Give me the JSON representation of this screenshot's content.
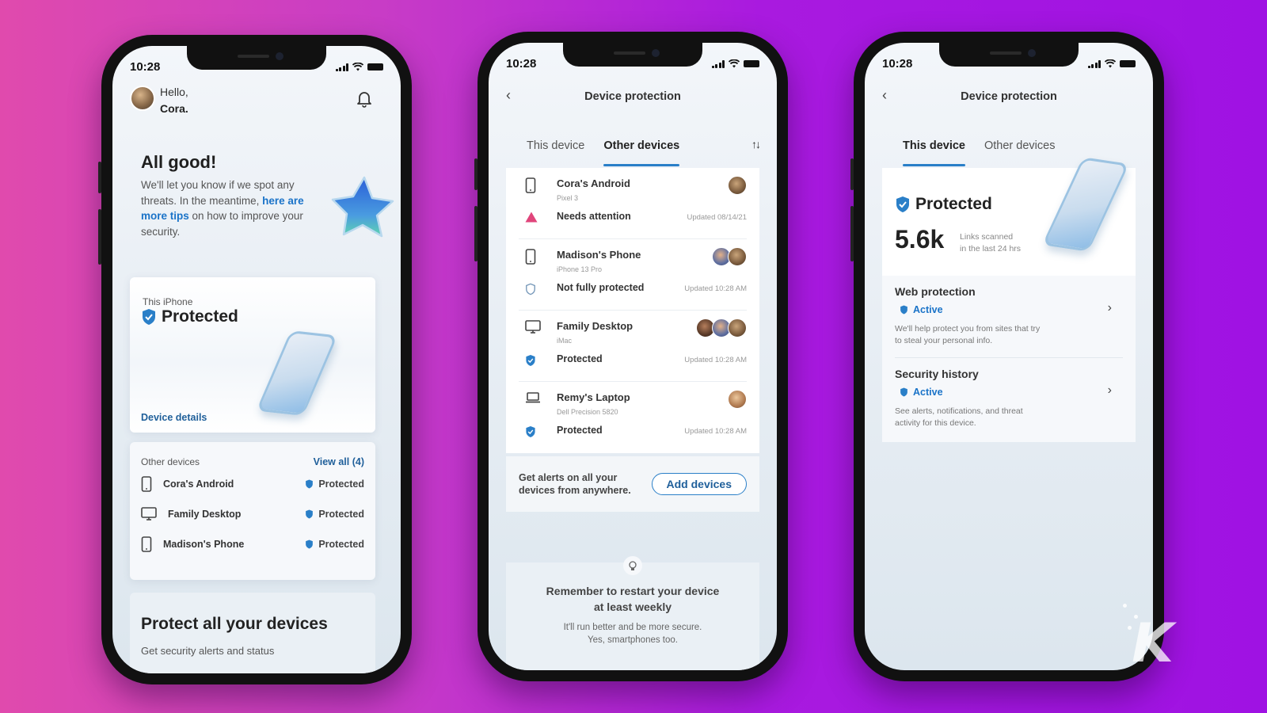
{
  "brand": {
    "accent": "#2a7fc8",
    "alert": "#e0457b",
    "background_left": "#e04aad",
    "background_right": "#9f12e3"
  },
  "phones": [
    {
      "status_bar": {
        "time": "10:28"
      },
      "greeting": {
        "hello": "Hello,",
        "name": "Cora."
      },
      "icons": {
        "notifications": "bell-icon"
      },
      "hero": {
        "title": "All good!",
        "body_before": "We'll let you know if we spot any threats. In the meantime, ",
        "link_text": "here are more tips",
        "body_after": " on how to improve your security."
      },
      "this_iphone": {
        "label": "This iPhone",
        "status": "Protected",
        "details_link": "Device details"
      },
      "other_devices": {
        "label": "Other devices",
        "view_all": "View all (4)",
        "items": [
          {
            "name": "Cora's Android",
            "icon": "phone-icon",
            "status": "Protected"
          },
          {
            "name": "Family Desktop",
            "icon": "desktop-icon",
            "status": "Protected"
          },
          {
            "name": "Madison's Phone",
            "icon": "phone-icon",
            "status": "Protected"
          }
        ]
      },
      "promo": {
        "title": "Protect all your devices",
        "subtitle": "Get security alerts and status"
      }
    },
    {
      "status_bar": {
        "time": "10:28"
      },
      "header": {
        "title": "Device protection",
        "back": "‹"
      },
      "tabs": [
        {
          "label": "This device",
          "active": false
        },
        {
          "label": "Other devices",
          "active": true
        }
      ],
      "sort_icon": "↑↓",
      "devices": [
        {
          "name": "Cora's Android",
          "model": "Pixel 3",
          "icon": "phone-icon",
          "status": "Needs attention",
          "status_icon": "warning-icon",
          "updated": "Updated 08/14/21",
          "avatars": [
            "av1"
          ]
        },
        {
          "name": "Madison's Phone",
          "model": "iPhone 13 Pro",
          "icon": "phone-icon",
          "status": "Not fully protected",
          "status_icon": "shield-outline-icon",
          "updated": "Updated 10:28 AM",
          "avatars": [
            "av2",
            "av1"
          ]
        },
        {
          "name": "Family Desktop",
          "model": "iMac",
          "icon": "desktop-icon",
          "status": "Protected",
          "status_icon": "shield-check-icon",
          "updated": "Updated 10:28 AM",
          "avatars": [
            "av3",
            "av2",
            "av1"
          ]
        },
        {
          "name": "Remy's Laptop",
          "model": "Dell Precision 5820",
          "icon": "laptop-icon",
          "status": "Protected",
          "status_icon": "shield-check-icon",
          "updated": "Updated 10:28 AM",
          "avatars": [
            "av4"
          ]
        }
      ],
      "alerts": {
        "text_line1": "Get alerts on all your",
        "text_line2": "devices from anywhere.",
        "button": "Add devices"
      },
      "tip": {
        "icon": "lightbulb-icon",
        "title_line1": "Remember to restart your device",
        "title_line2": "at least weekly",
        "sub_line1": "It'll run better and be more secure.",
        "sub_line2": "Yes, smartphones too."
      }
    },
    {
      "status_bar": {
        "time": "10:28"
      },
      "header": {
        "title": "Device protection",
        "back": "‹"
      },
      "tabs": [
        {
          "label": "This device",
          "active": true
        },
        {
          "label": "Other devices",
          "active": false
        }
      ],
      "summary": {
        "status": "Protected",
        "stat_value": "5.6k",
        "stat_label_line1": "Links scanned",
        "stat_label_line2": "in the last 24 hrs"
      },
      "features": [
        {
          "title": "Web protection",
          "state": "Active",
          "desc_line1": "We'll help protect you from sites that try",
          "desc_line2": "to steal your personal info."
        },
        {
          "title": "Security history",
          "state": "Active",
          "desc_line1": "See alerts, notifications, and threat",
          "desc_line2": "activity for this device."
        }
      ]
    }
  ],
  "watermark": "K"
}
